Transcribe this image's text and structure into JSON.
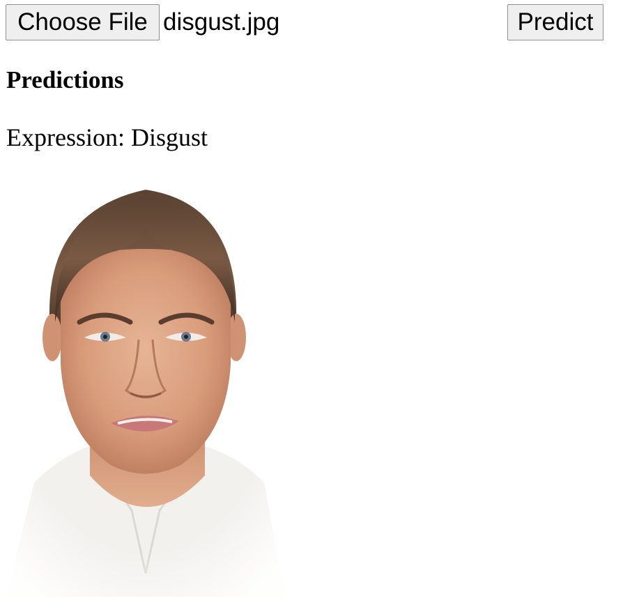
{
  "upload": {
    "choose_file_label": "Choose File",
    "selected_file": "disgust.jpg",
    "predict_label": "Predict"
  },
  "predictions": {
    "heading": "Predictions",
    "label": "Expression:",
    "value": "Disgust",
    "line": "Expression: Disgust"
  },
  "image": {
    "subject": "woman with disgusted facial expression",
    "icon": "uploaded-photo"
  },
  "colors": {
    "button_bg": "#efefef",
    "button_border": "#8f8f8f",
    "text": "#000000",
    "background": "#ffffff"
  }
}
